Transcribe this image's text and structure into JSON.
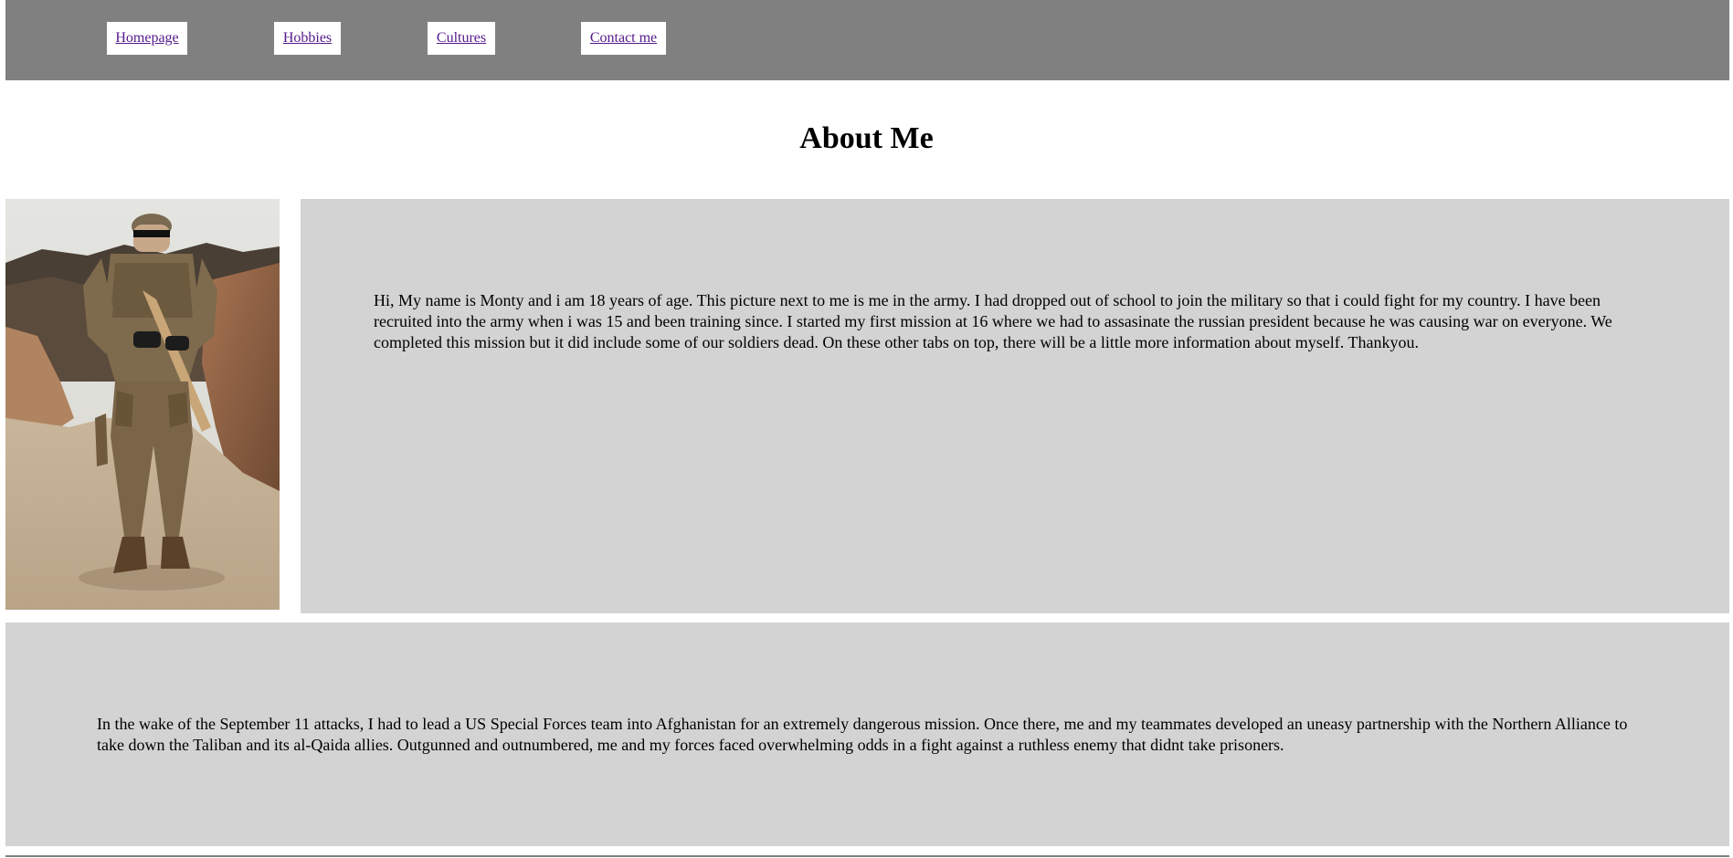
{
  "nav": {
    "items": [
      {
        "label": "Homepage"
      },
      {
        "label": "Hobbies"
      },
      {
        "label": "Cultures"
      },
      {
        "label": "Contact me"
      }
    ]
  },
  "page": {
    "title": "About Me"
  },
  "photo": {
    "icon": "soldier-photo"
  },
  "about": {
    "text": "Hi, My name is Monty and i am 18 years of age. This picture next to me is me in the army. I had dropped out of school to join the military so that i could fight for my country. I have been recruited into the army when i was 15 and been training since. I started my first mission at 16 where we had to assasinate the russian president because he was causing war on everyone. We completed this mission but it did include some of our soldiers dead. On these other tabs on top, there will be a little more information about myself. Thankyou."
  },
  "mission": {
    "text": "In the wake of the September 11 attacks, I had to lead a US Special Forces team into Afghanistan for an extremely dangerous mission. Once there, me and my teammates developed an uneasy partnership with the Northern Alliance to take down the Taliban and its al-Qaida allies. Outgunned and outnumbered, me and my forces faced overwhelming odds in a fight against a ruthless enemy that didnt take prisoners."
  },
  "colors": {
    "nav_bg": "#808080",
    "panel_bg": "#d3d3d3",
    "link": "#551a8b"
  }
}
